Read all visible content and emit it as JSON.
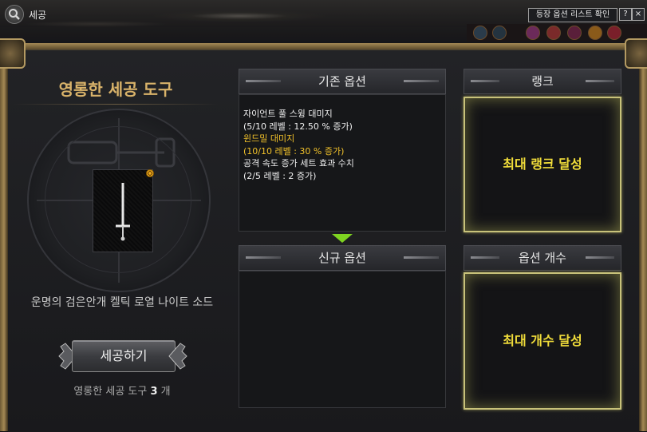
{
  "window": {
    "title": "세공",
    "list_button": "등장 옵션 리스트 확인",
    "help_label": "?",
    "close_label": "×"
  },
  "tool": {
    "title": "영롱한 세공 도구",
    "item_name": "운명의 검은안개 켈틱 로열 나이트 소드",
    "refine_button": "세공하기",
    "count_prefix": "영롱한 세공 도구",
    "count_value": "3",
    "count_suffix": "개"
  },
  "existing_options": {
    "header": "기존 옵션",
    "lines": [
      {
        "text": "자이언트 풀 스윙 대미지",
        "color": "#f0f0f0"
      },
      {
        "text": "(5/10 레벨 : 12.50 % 증가)",
        "color": "#f0f0f0"
      },
      {
        "text": "윈드밀 대미지",
        "color": "#f2c22a"
      },
      {
        "text": "(10/10 레벨 : 30 % 증가)",
        "color": "#f2c22a"
      },
      {
        "text": "공격 속도 증가 세트 효과 수치",
        "color": "#f0f0f0"
      },
      {
        "text": "(2/5 레벨 : 2 증가)",
        "color": "#f0f0f0"
      }
    ]
  },
  "new_options": {
    "header": "신규 옵션"
  },
  "rank": {
    "header": "랭크",
    "status": "최대 랭크 달성"
  },
  "option_count": {
    "header": "옵션 개수",
    "status": "최대 개수 달성"
  },
  "colors": {
    "gold_title": "#d9b36a",
    "highlight_yellow": "#f2c22a",
    "status_yellow": "#f0dc3a",
    "arrow_green": "#7ed321"
  }
}
